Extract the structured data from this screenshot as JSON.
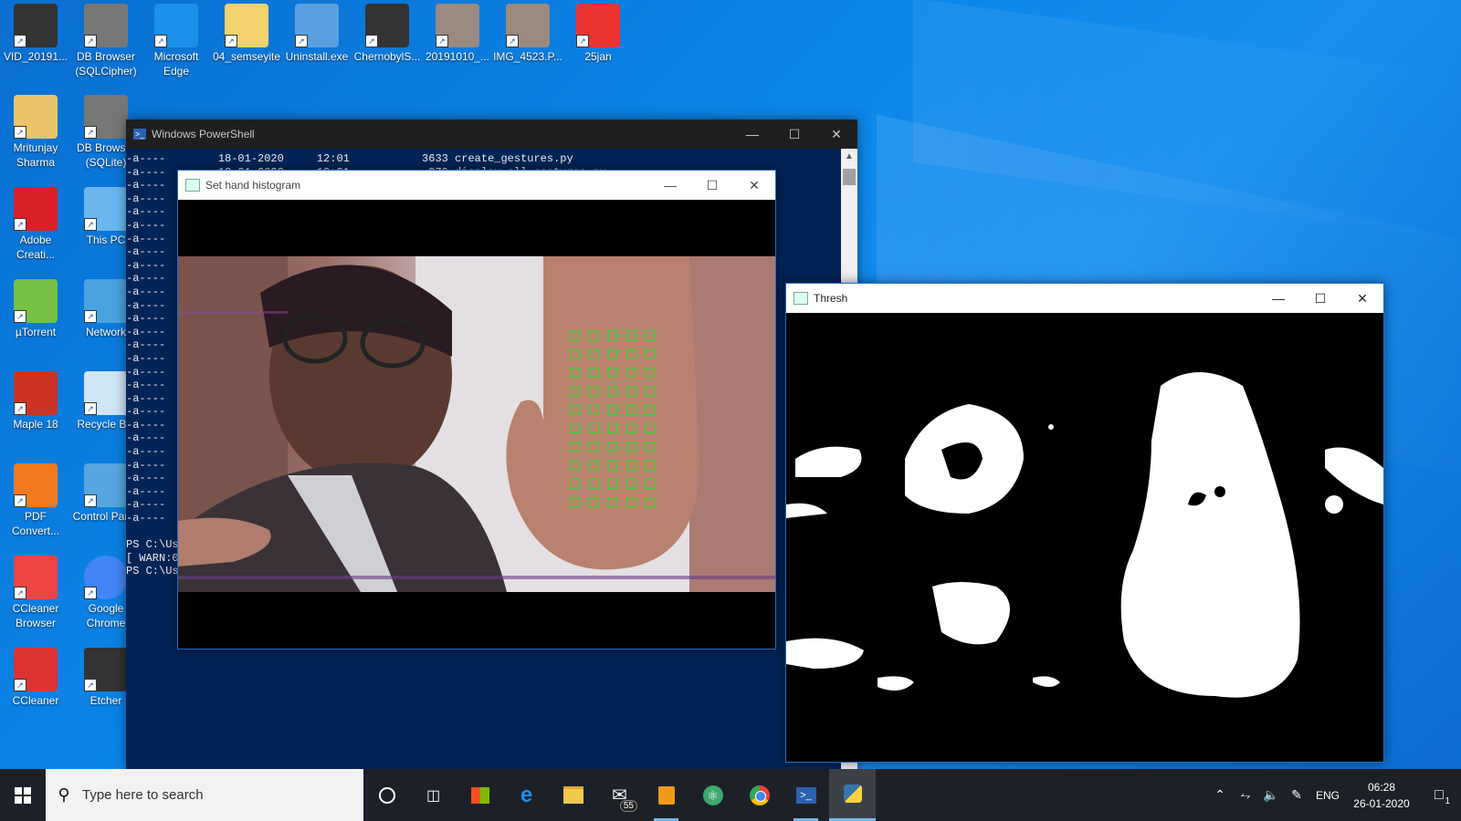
{
  "desktop": {
    "icons": [
      {
        "label": "VID_20191...",
        "icon": "video-file-icon"
      },
      {
        "label": "DB Browser (SQLCipher)",
        "icon": "database-icon"
      },
      {
        "label": "Microsoft Edge",
        "icon": "edge-icon"
      },
      {
        "label": "04_semseyite",
        "icon": "folder-icon"
      },
      {
        "label": "Uninstall.exe",
        "icon": "installer-icon"
      },
      {
        "label": "ChernobylS...",
        "icon": "video-file-icon"
      },
      {
        "label": "20191010_...",
        "icon": "image-file-icon"
      },
      {
        "label": "IMG_4523.P...",
        "icon": "image-file-icon"
      },
      {
        "label": "25jan",
        "icon": "pdf-icon"
      },
      {
        "label": "Mritunjay Sharma",
        "icon": "user-folder-icon"
      },
      {
        "label": "DB Browser (SQLite)",
        "icon": "database-icon"
      },
      {
        "label": "Adobe Creati...",
        "icon": "adobe-cc-icon"
      },
      {
        "label": "This PC",
        "icon": "computer-icon"
      },
      {
        "label": "µTorrent",
        "icon": "utorrent-icon"
      },
      {
        "label": "Network",
        "icon": "network-icon"
      },
      {
        "label": "Maple 18",
        "icon": "maple-icon"
      },
      {
        "label": "Recycle Bin",
        "icon": "recycle-bin-icon"
      },
      {
        "label": "PDF Convert...",
        "icon": "pdf-converter-icon"
      },
      {
        "label": "Control Panel",
        "icon": "control-panel-icon"
      },
      {
        "label": "CCleaner Browser",
        "icon": "ccleaner-browser-icon"
      },
      {
        "label": "Google Chrome",
        "icon": "chrome-icon"
      },
      {
        "label": "CCleaner",
        "icon": "ccleaner-icon"
      },
      {
        "label": "Etcher",
        "icon": "etcher-icon"
      }
    ]
  },
  "powershell": {
    "title": "Windows PowerShell",
    "lines": [
      "-a----        18-01-2020     12:01           3633 create_gestures.py",
      "-a----        18-01-2020     12:01            979 display_all_gestures.py",
      "-a----",
      "-a----",
      "-a----",
      "-a----",
      "-a----",
      "-a----",
      "-a----",
      "-a----",
      "-a----",
      "-a----",
      "-a----",
      "-a----",
      "-a----",
      "-a----",
      "-a----",
      "-a----",
      "-a----",
      "-a----",
      "-a----",
      "-a----",
      "-a----",
      "-a----",
      "-a----",
      "-a----",
      "-a----",
      "-a----",
      "",
      "PS C:\\Use",
      "[ WARN:0]",
      "PS C:\\Use"
    ]
  },
  "hist_window": {
    "title": "Set hand histogram"
  },
  "thresh_window": {
    "title": "Thresh"
  },
  "taskbar": {
    "search_placeholder": "Type here to search",
    "mail_badge": "55",
    "language": "ENG",
    "time": "06:28",
    "date": "26-01-2020",
    "notification_count": "1",
    "accent": "#76b9ed"
  }
}
